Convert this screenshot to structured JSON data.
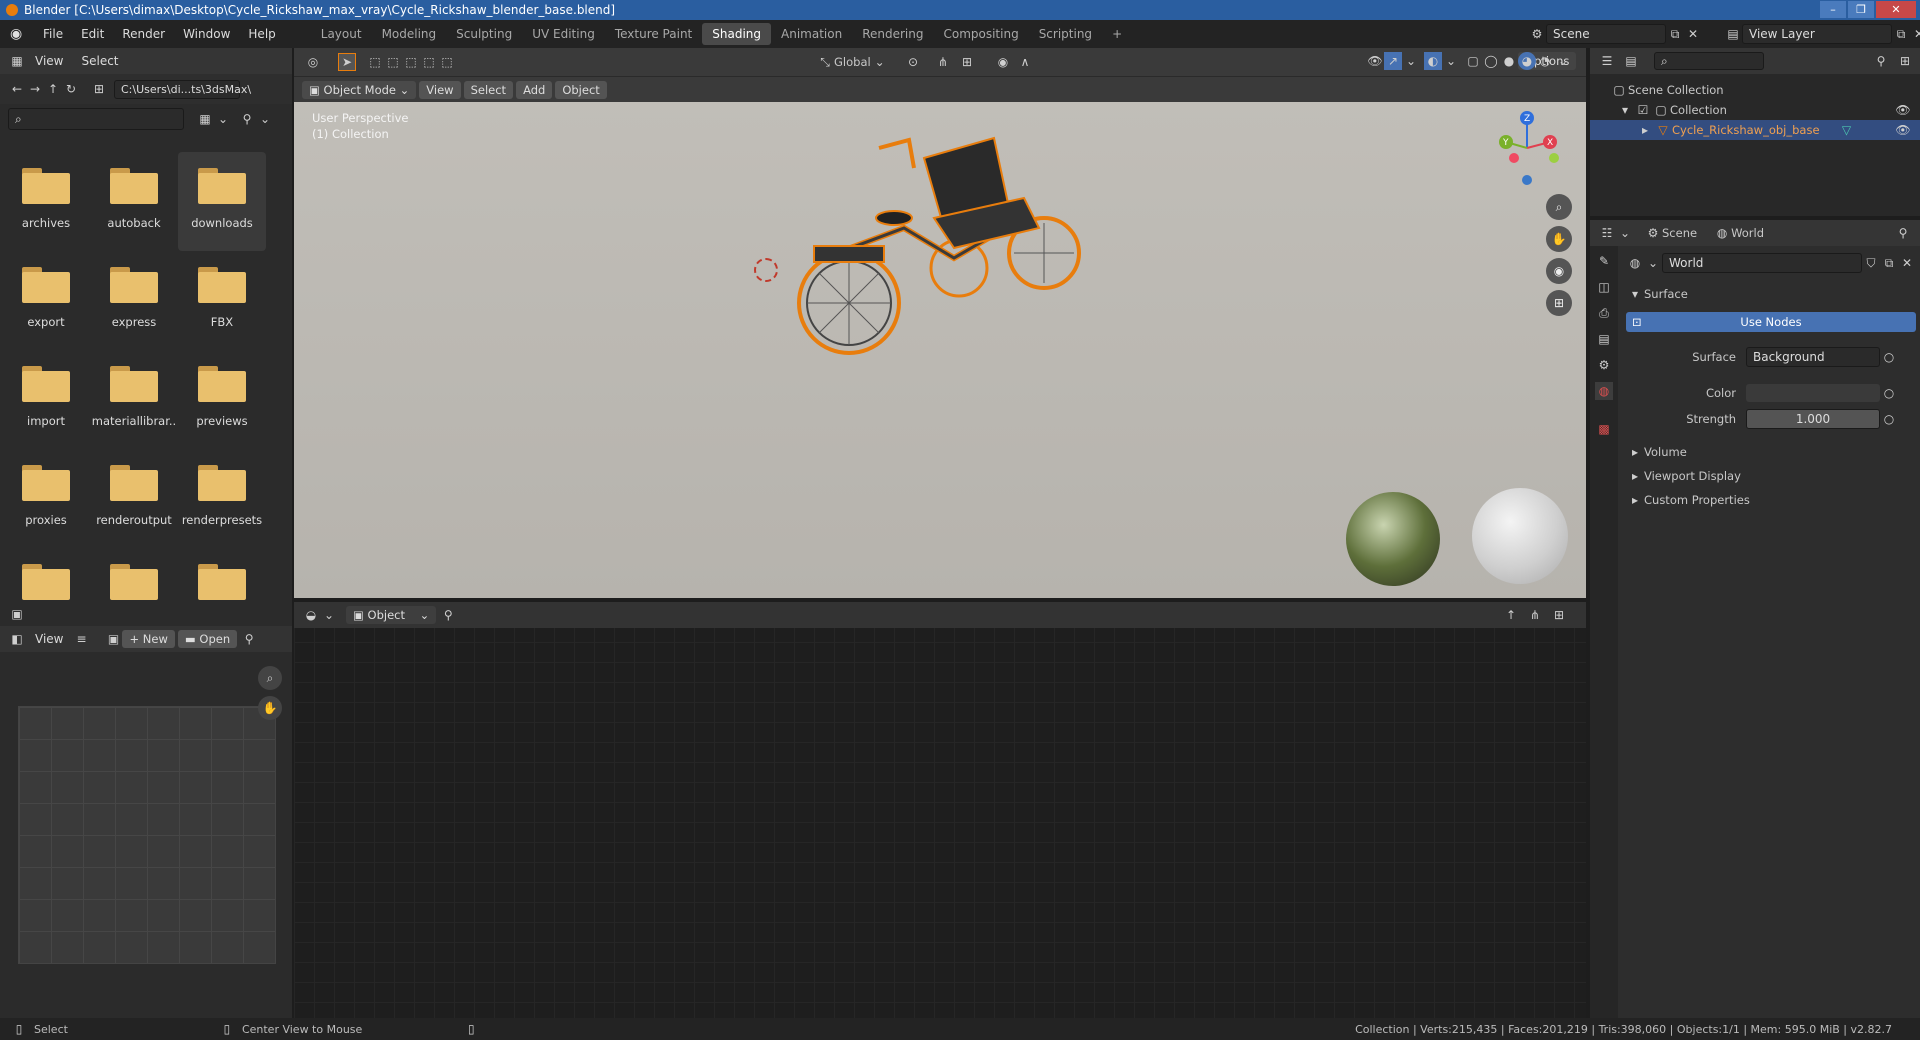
{
  "window": {
    "title": "Blender [C:\\Users\\dimax\\Desktop\\Cycle_Rickshaw_max_vray\\Cycle_Rickshaw_blender_base.blend]"
  },
  "menu": [
    "File",
    "Edit",
    "Render",
    "Window",
    "Help"
  ],
  "workspaces": [
    {
      "label": "Layout"
    },
    {
      "label": "Modeling"
    },
    {
      "label": "Sculpting"
    },
    {
      "label": "UV Editing"
    },
    {
      "label": "Texture Paint"
    },
    {
      "label": "Shading",
      "active": true
    },
    {
      "label": "Animation"
    },
    {
      "label": "Rendering"
    },
    {
      "label": "Compositing"
    },
    {
      "label": "Scripting"
    }
  ],
  "workspace_add": "+",
  "scene": {
    "name": "Scene",
    "view_layer": "View Layer"
  },
  "filebrowser": {
    "menu": [
      "View",
      "Select"
    ],
    "path": "C:\\Users\\di...ts\\3dsMax\\",
    "folders": [
      "archives",
      "autoback",
      "downloads",
      "export",
      "express",
      "FBX",
      "import",
      "materiallibrar..",
      "previews",
      "proxies",
      "renderoutput",
      "renderpresets",
      "",
      "",
      ""
    ],
    "selected": "downloads"
  },
  "viewport": {
    "mode": "Object Mode",
    "menu": [
      "View",
      "Select",
      "Add",
      "Object"
    ],
    "transform": "Global",
    "options": "Options",
    "info_line1": "User Perspective",
    "info_line2": "(1) Collection",
    "gizmo": {
      "x": "X",
      "y": "Y",
      "z": "Z"
    }
  },
  "imageeditor": {
    "view": "View",
    "new": "New",
    "open": "Open"
  },
  "nodeeditor": {
    "type": "Object"
  },
  "outliner": {
    "root": "Scene Collection",
    "collection": "Collection",
    "object": "Cycle_Rickshaw_obj_base"
  },
  "properties": {
    "breadcrumb_scene": "Scene",
    "breadcrumb_world": "World",
    "world_name": "World",
    "surface_panel": "Surface",
    "use_nodes": "Use Nodes",
    "surface_label": "Surface",
    "surface_value": "Background",
    "color_label": "Color",
    "strength_label": "Strength",
    "strength_value": "1.000",
    "panels": [
      "Volume",
      "Viewport Display",
      "Custom Properties"
    ]
  },
  "statusbar": {
    "select": "Select",
    "center": "Center View to Mouse",
    "stats": "Collection | Verts:215,435 | Faces:201,219 | Tris:398,060 | Objects:1/1 | Mem: 595.0 MiB | v2.82.7"
  },
  "colors": {
    "accent": "#4772b3",
    "selection": "#e87d0d",
    "folder": "#e9c06d"
  }
}
